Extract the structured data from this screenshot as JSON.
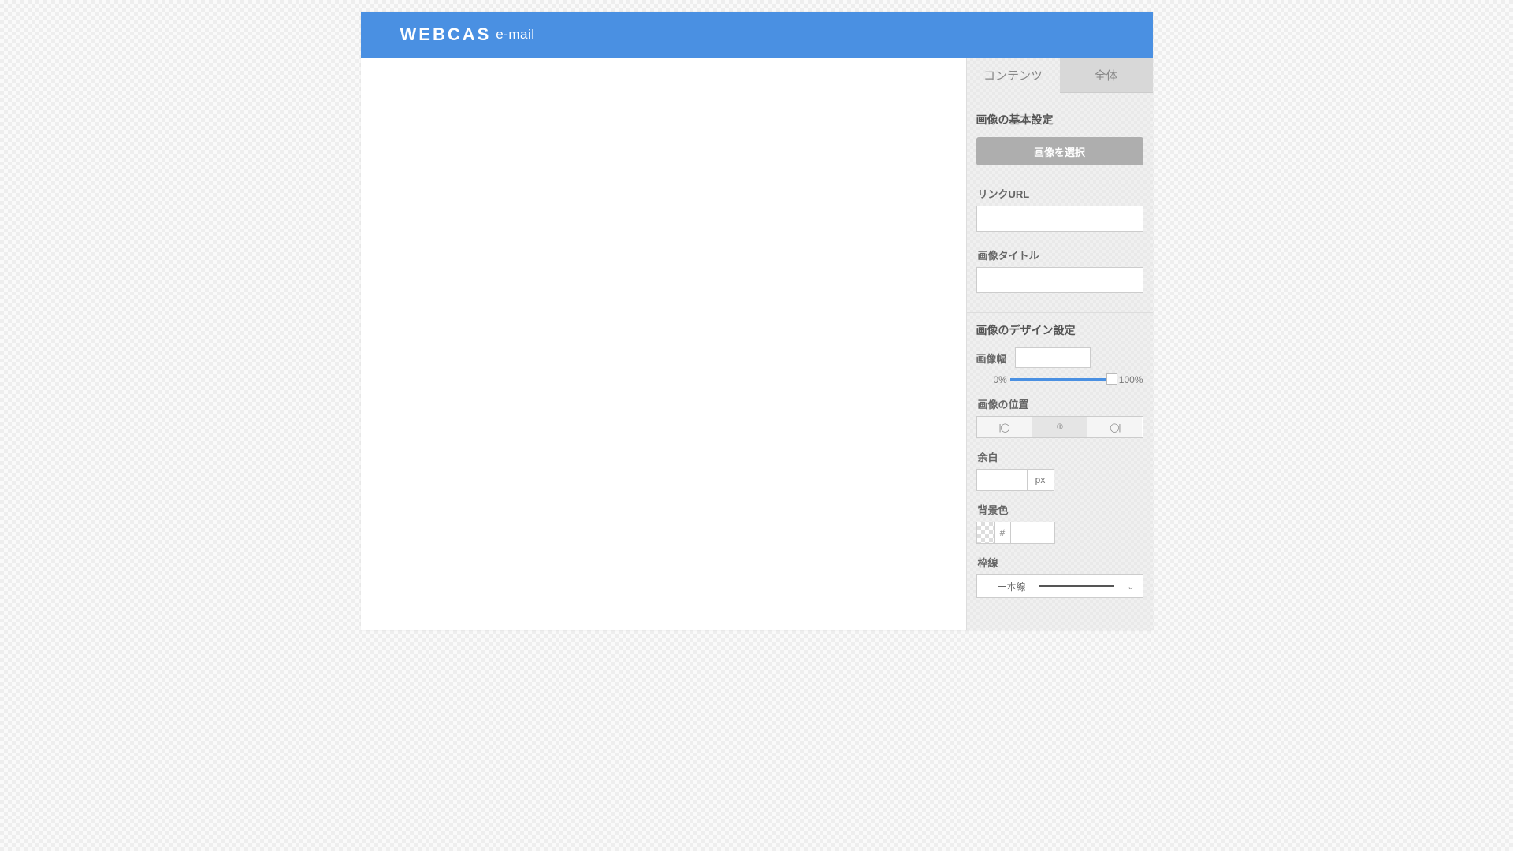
{
  "header": {
    "logo_main": "WEBCAS",
    "logo_sub": "e-mail"
  },
  "tabs": {
    "contents": "コンテンツ",
    "all": "全体"
  },
  "panel": {
    "section_basic": "画像の基本設定",
    "select_image_btn": "画像を選択",
    "link_url_label": "リンクURL",
    "link_url_value": "",
    "image_title_label": "画像タイトル",
    "image_title_value": "",
    "section_design": "画像のデザイン設定",
    "image_width_label": "画像幅",
    "image_width_value": "",
    "slider_min": "0%",
    "slider_max": "100%",
    "image_position_label": "画像の位置",
    "margin_label": "余白",
    "margin_value": "",
    "margin_unit": "px",
    "bgcolor_label": "背景色",
    "bgcolor_hash": "#",
    "bgcolor_value": "",
    "border_label": "枠線",
    "border_select_value": "一本線"
  }
}
